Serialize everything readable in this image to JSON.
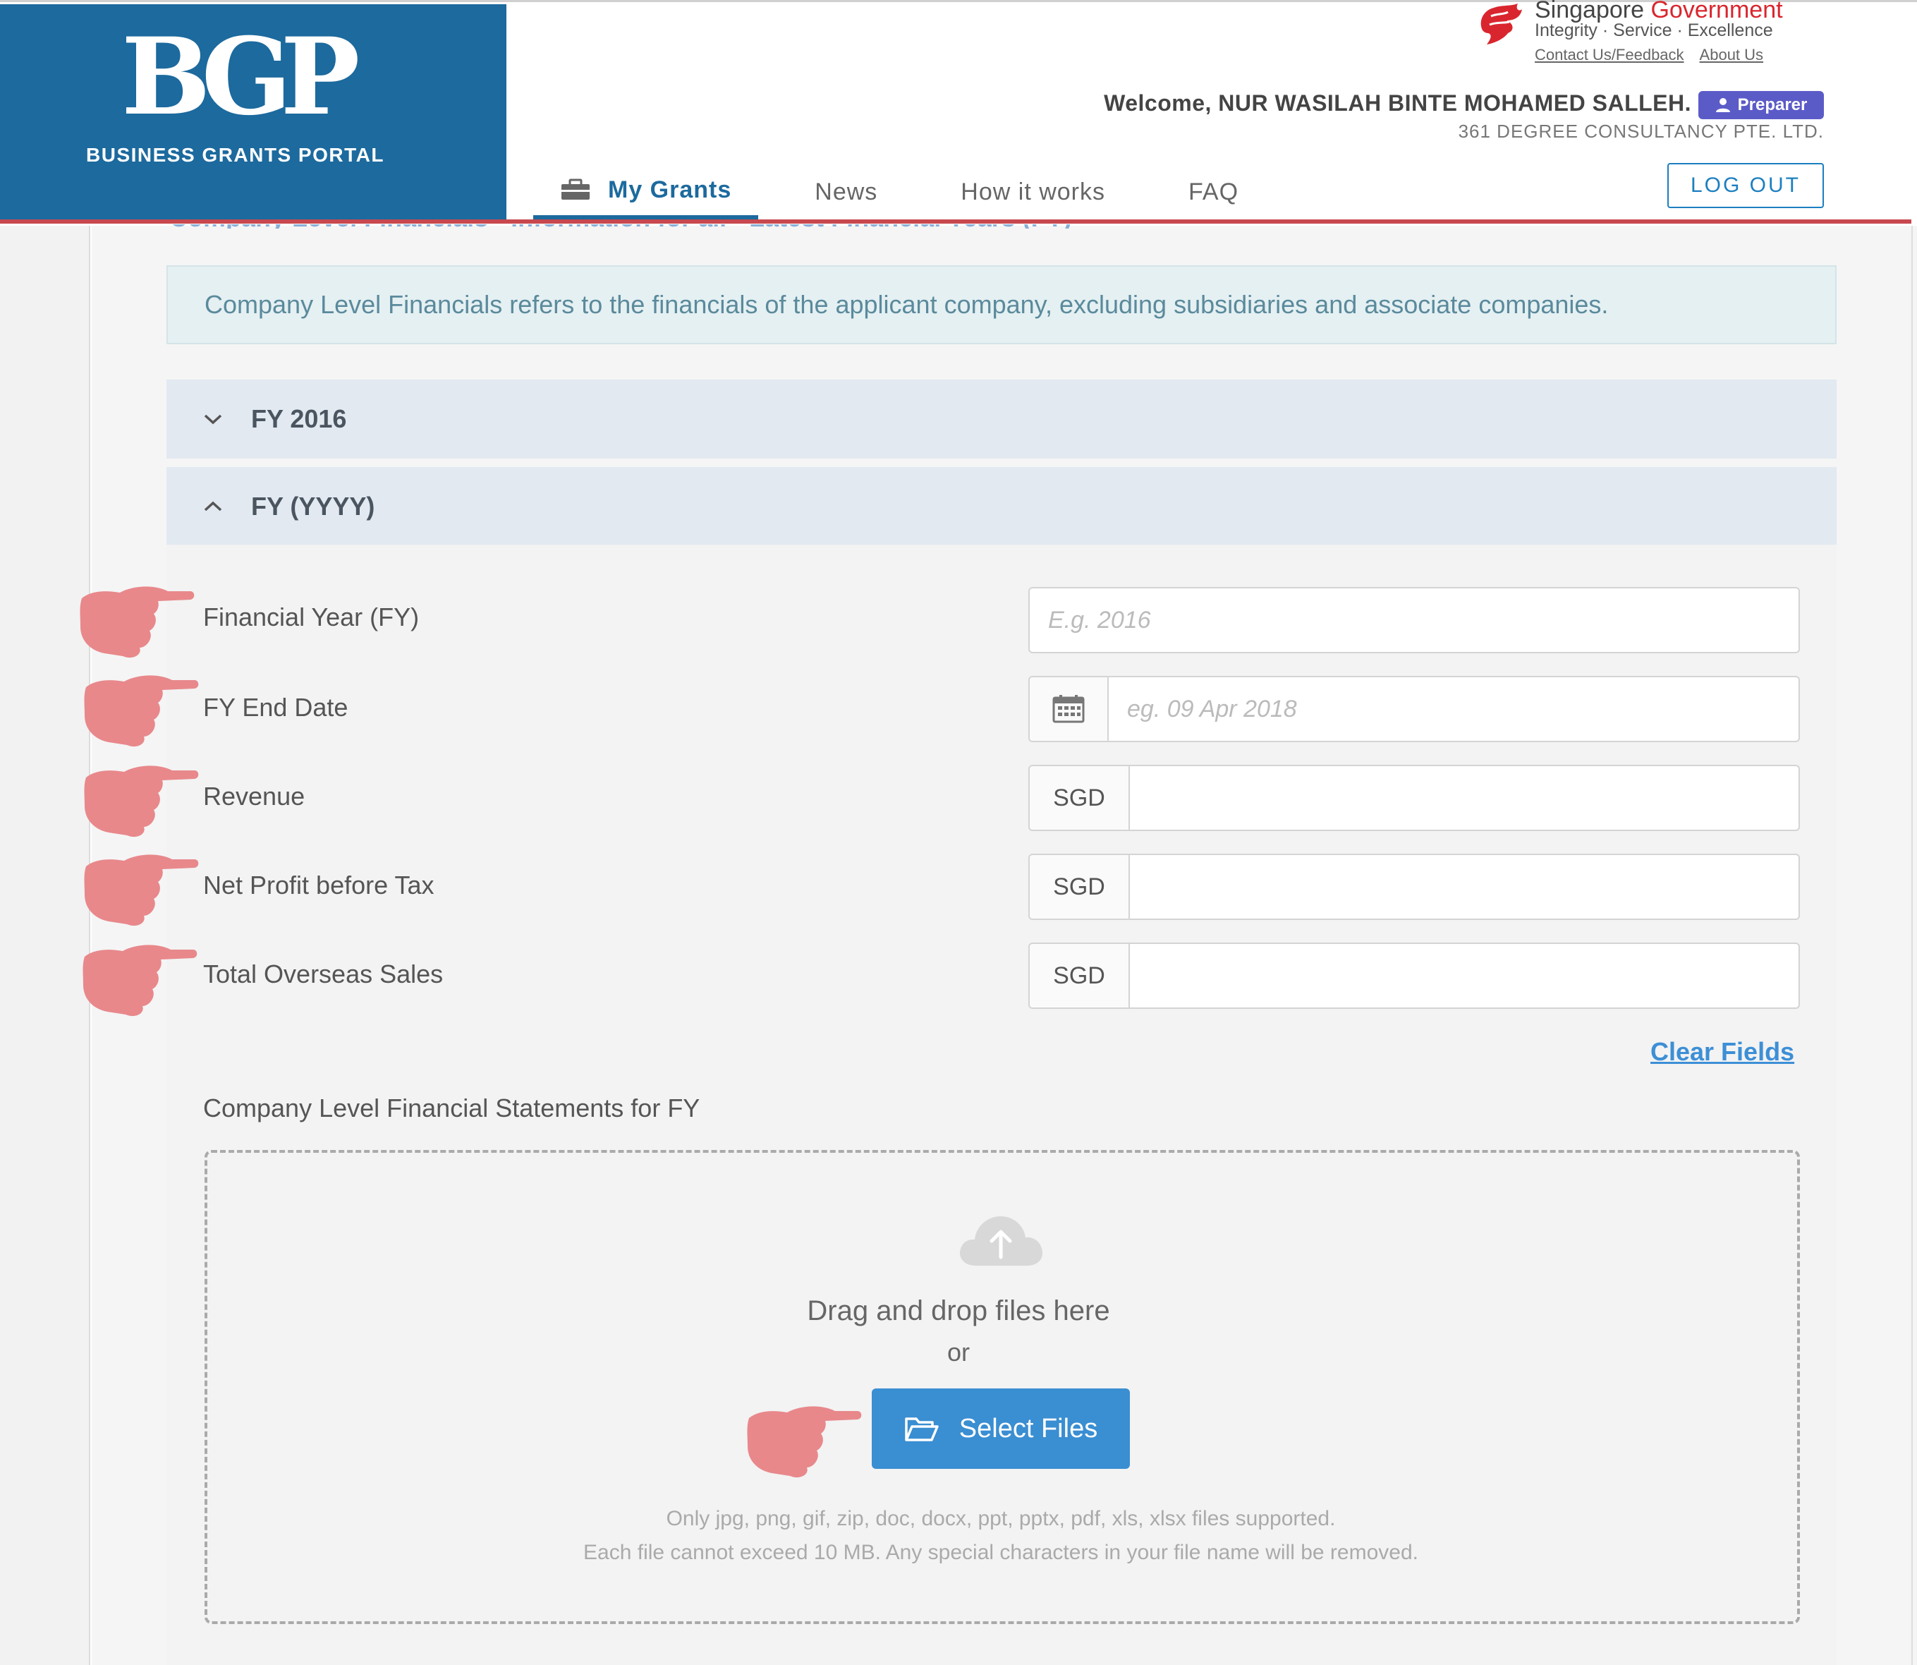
{
  "header": {
    "logo": "BGP",
    "logo_sub": "BUSINESS GRANTS PORTAL",
    "gov_title_a": "Singapore ",
    "gov_title_b": "Government",
    "gov_tagline": "Integrity · Service · Excellence",
    "gov_links": [
      "Contact Us/Feedback",
      "About Us"
    ],
    "welcome": "Welcome, NUR WASILAH BINTE MOHAMED SALLEH.",
    "role": "Preparer",
    "company": "361 DEGREE CONSULTANCY PTE. LTD.",
    "logout": "LOG OUT",
    "nav": [
      "My Grants",
      "News",
      "How it works",
      "FAQ"
    ]
  },
  "breadcrumb_peek": "Company Level Financials · Information for all · Latest Financial Years (FY)",
  "info": "Company Level Financials refers to the financials of the applicant company, excluding subsidiaries and associate companies.",
  "accordions": {
    "fy2016": "FY 2016",
    "fyyyyy": "FY (YYYY)"
  },
  "form": {
    "fy_label": "Financial Year (FY)",
    "fy_placeholder": "E.g. 2016",
    "end_label": "FY End Date",
    "end_placeholder": "eg. 09 Apr 2018",
    "revenue_label": "Revenue",
    "profit_label": "Net Profit before Tax",
    "overseas_label": "Total Overseas Sales",
    "currency": "SGD",
    "clear": "Clear Fields"
  },
  "upload": {
    "label": "Company Level Financial Statements for FY",
    "drop_title": "Drag and drop files here",
    "or": "or",
    "button": "Select Files",
    "hint1": "Only jpg, png, gif, zip, doc, docx, ppt, pptx, pdf, xls, xlsx files supported.",
    "hint2": "Each file cannot exceed 10 MB. Any special characters in your file name will be removed."
  },
  "colors": {
    "brand": "#1c6a9e",
    "accent_red": "#c8484f",
    "pointer": "#e8888b",
    "button": "#3a8ed2"
  }
}
